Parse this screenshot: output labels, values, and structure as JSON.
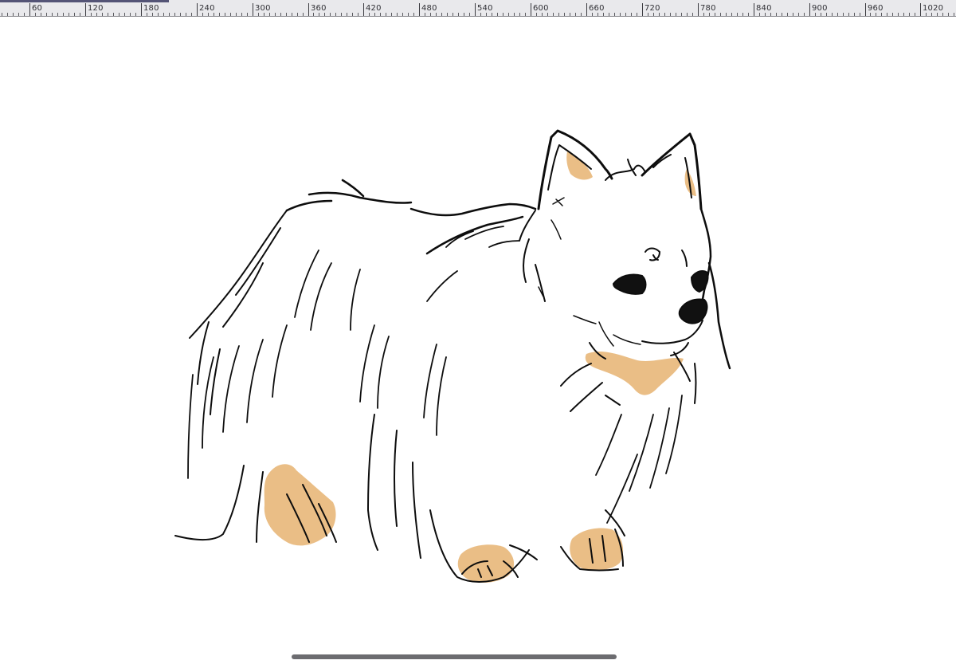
{
  "ruler": {
    "labels": [
      "60",
      "120",
      "180",
      "240",
      "300",
      "360",
      "420",
      "480",
      "540",
      "600",
      "660",
      "720",
      "780",
      "840",
      "900",
      "960",
      "1020"
    ],
    "highlight_color": "#545476"
  },
  "canvas": {
    "background": "#ffffff",
    "ink_color": "#0d0d0d",
    "accent_color": "#e8b87c",
    "artwork": "pomeranian-dog-sketch"
  },
  "home_indicator": {
    "color": "#6c6c70"
  }
}
